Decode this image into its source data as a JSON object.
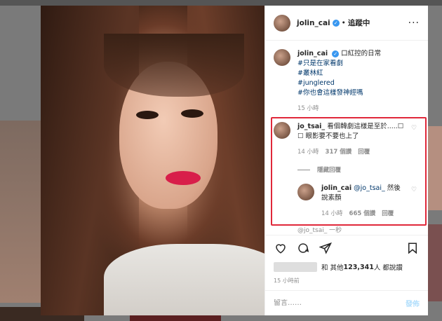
{
  "header": {
    "username": "jolin_cai",
    "separator": "•",
    "follow_state": "追蹤中",
    "more": "···"
  },
  "caption": {
    "username": "jolin_cai",
    "text": "口紅控的日常",
    "tags": [
      "#只是在家看劇",
      "#叢林紅",
      "#junglered",
      "#你也會這樣發神經嗎"
    ],
    "time": "15 小時"
  },
  "comments": [
    {
      "username": "jo_tsai_",
      "text": "看個韓劇這樣是至於.....☐ ☐ 眼影要不要也上了",
      "time": "14 小時",
      "likes": "317 個讚",
      "reply_label": "回覆"
    }
  ],
  "view_replies": "隱藏回覆",
  "reply": {
    "username": "jolin_cai",
    "mention": "@jo_tsai_",
    "text": "然後說素顏",
    "time": "14 小時",
    "likes": "665 個讚",
    "reply_label": "回覆"
  },
  "partial_comment": "@jo_tsai_ 一秒",
  "likes_line": {
    "prefix": "和 其他 ",
    "count": "123,341",
    "suffix": " 人 都說讚"
  },
  "post_time": "15 小時前",
  "composer": {
    "placeholder": "留言……",
    "post_label": "發佈"
  },
  "colors": {
    "highlight": "#e0283a",
    "link": "#00376b",
    "verified": "#3897f0"
  }
}
